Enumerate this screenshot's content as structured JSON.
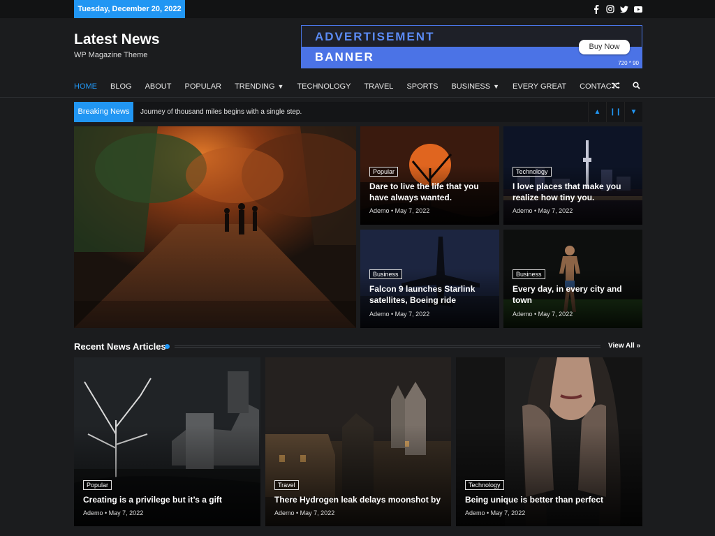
{
  "topbar": {
    "date": "Tuesday, December 20, 2022"
  },
  "social_icons": [
    "facebook-icon",
    "instagram-icon",
    "twitter-icon",
    "youtube-icon"
  ],
  "header": {
    "title": "Latest News",
    "tagline": "WP Magazine Theme"
  },
  "ad": {
    "line1": "ADVERTISEMENT",
    "line2": "BANNER",
    "button": "Buy Now",
    "size": "720 * 90"
  },
  "nav": {
    "items": [
      {
        "label": "HOME",
        "active": true,
        "dropdown": false
      },
      {
        "label": "BLOG",
        "active": false,
        "dropdown": false
      },
      {
        "label": "ABOUT",
        "active": false,
        "dropdown": false
      },
      {
        "label": "POPULAR",
        "active": false,
        "dropdown": false
      },
      {
        "label": "TRENDING",
        "active": false,
        "dropdown": true
      },
      {
        "label": "TECHNOLOGY",
        "active": false,
        "dropdown": false
      },
      {
        "label": "TRAVEL",
        "active": false,
        "dropdown": false
      },
      {
        "label": "SPORTS",
        "active": false,
        "dropdown": false
      },
      {
        "label": "BUSINESS",
        "active": false,
        "dropdown": true
      },
      {
        "label": "EVERY GREAT",
        "active": false,
        "dropdown": false
      },
      {
        "label": "CONTACT",
        "active": false,
        "dropdown": false
      }
    ]
  },
  "breaking": {
    "label": "Breaking News",
    "text": "Journey of thousand miles begins with a single step."
  },
  "hero_posts": [
    {
      "tag": "Popular",
      "title_line1": "Dare to live the life that you",
      "title_line2": "have always wanted.",
      "meta": "Ademo • May 7, 2022"
    },
    {
      "tag": "Technology",
      "title_line1": "I love places that make you",
      "title_line2": "realize how tiny you.",
      "meta": "Ademo • May 7, 2022"
    },
    {
      "tag": "Business",
      "title_line1": "Falcon 9 launches Starlink",
      "title_line2": "satellites, Boeing ride",
      "meta": "Ademo • May 7, 2022"
    },
    {
      "tag": "Business",
      "title_line1": "Every day, in every city and",
      "title_line2": "town",
      "meta": "Ademo • May 7, 2022"
    }
  ],
  "recent": {
    "heading": "Recent News Articles",
    "view_all": "View All",
    "articles": [
      {
        "tag": "Popular",
        "title": "Creating is a privilege but it’s a gift",
        "meta": "Ademo • May 7, 2022"
      },
      {
        "tag": "Travel",
        "title": "There Hydrogen leak delays moonshot by",
        "meta": "Ademo • May 7, 2022"
      },
      {
        "tag": "Technology",
        "title": "Being unique is better than perfect",
        "meta": "Ademo • May 7, 2022"
      }
    ]
  },
  "colors": {
    "accent": "#2196f3",
    "background": "#1b1c1e",
    "ad_blue": "#4b73e6"
  }
}
